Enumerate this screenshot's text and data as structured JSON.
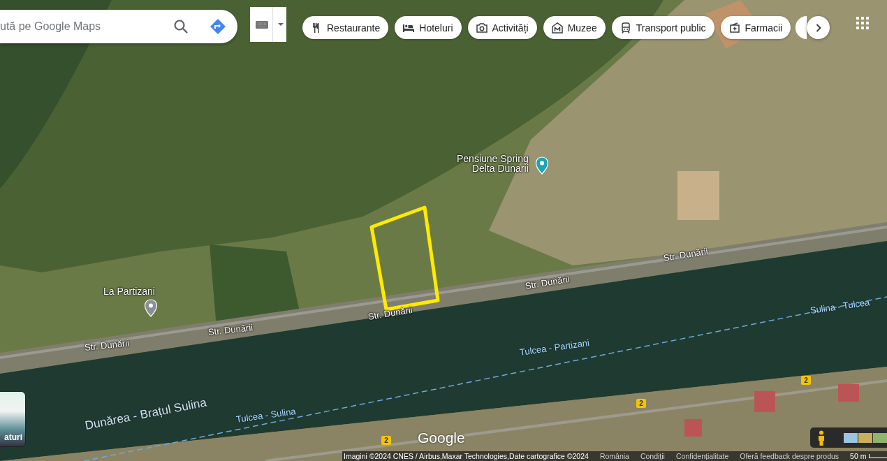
{
  "search": {
    "placeholder": "ută pe Google Maps"
  },
  "chips": [
    {
      "label": "Restaurante",
      "kind": "restaurant"
    },
    {
      "label": "Hoteluri",
      "kind": "hotel"
    },
    {
      "label": "Activități",
      "kind": "camera"
    },
    {
      "label": "Muzee",
      "kind": "museum"
    },
    {
      "label": "Transport public",
      "kind": "transit"
    },
    {
      "label": "Farmacii",
      "kind": "pharmacy"
    }
  ],
  "places": [
    {
      "lines": [
        "Pensiune Spring",
        "Delta Dunarii"
      ],
      "color": "#1ba5b8"
    },
    {
      "lines": [
        "La Partizani"
      ],
      "color": "#8a9096"
    }
  ],
  "roads": [
    "Str. Dunării",
    "Str. Dunării",
    "Str. Dunării",
    "Str. Dunării",
    "Str. Dunării"
  ],
  "ferries": [
    "Sulina - Tulcea",
    "Tulcea - Partizani",
    "Tulcea - Sulina"
  ],
  "river": "Dunărea - Brațul Sulina",
  "shields": [
    "2",
    "2",
    "2"
  ],
  "layers_button": {
    "label": "aturi"
  },
  "footer": {
    "logo": "Google",
    "attribution": "Imagini ©2024 CNES / Airbus,Maxar Technologies,Date cartografice ©2024",
    "links": [
      "România",
      "Condiții",
      "Confidențialitate",
      "Oferă feedback despre produs"
    ],
    "scale": "50 m"
  }
}
